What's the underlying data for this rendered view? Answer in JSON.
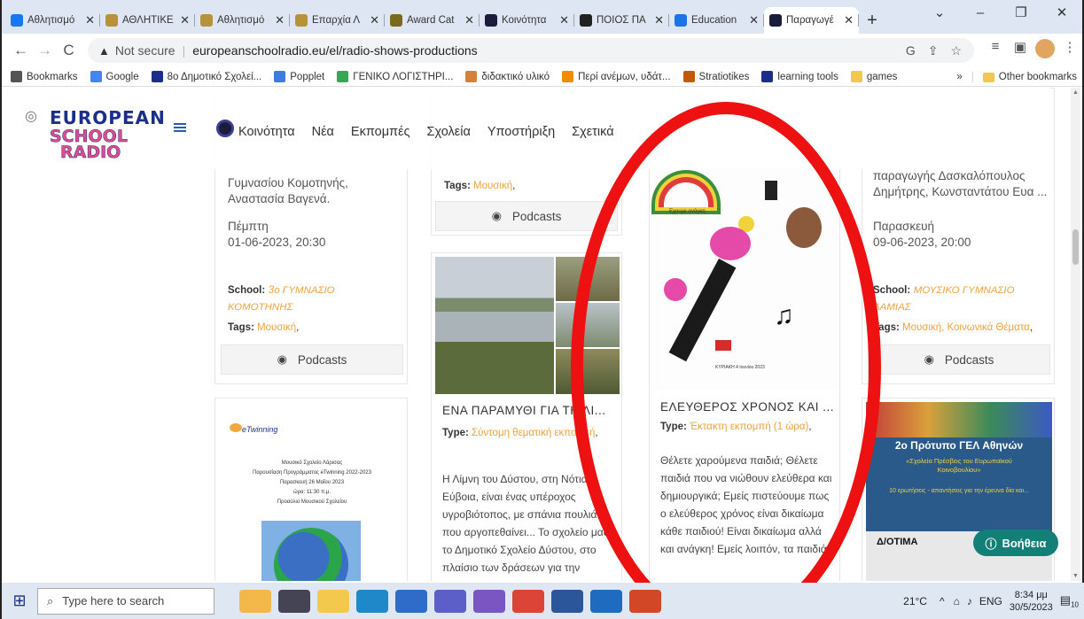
{
  "browser": {
    "tabs": [
      {
        "title": "Αθλητισμό",
        "color": "#1877f2",
        "active": false
      },
      {
        "title": "ΑΘΛΗΤΙΚΕ",
        "color": "#b8923a",
        "active": false
      },
      {
        "title": "Αθλητισμό",
        "color": "#b8923a",
        "active": false
      },
      {
        "title": "Επαρχία Λ",
        "color": "#b8923a",
        "active": false
      },
      {
        "title": "Award Cat",
        "color": "#7a6a1e",
        "active": false
      },
      {
        "title": "Κοινότητα",
        "color": "#1b1b3a",
        "active": false
      },
      {
        "title": "ΠΟΙΟΣ ΠΑ",
        "color": "#222222",
        "active": false
      },
      {
        "title": "Education",
        "color": "#1a73e8",
        "active": false
      },
      {
        "title": "Παραγωγέ",
        "color": "#1b1b3a",
        "active": true
      }
    ],
    "new_tab": "+",
    "window_controls": [
      "⌄",
      "–",
      "❐",
      "✕"
    ],
    "address": {
      "security": "Not secure",
      "url": "europeanschoolradio.eu/el/radio-shows-productions"
    },
    "bookmarks": [
      {
        "label": "Bookmarks",
        "color": "#555555"
      },
      {
        "label": "Google",
        "color": "#4285f4"
      },
      {
        "label": "8ο Δημοτικό Σχολεί...",
        "color": "#1b2f8a"
      },
      {
        "label": "Popplet",
        "color": "#3d7be0"
      },
      {
        "label": "ΓΕΝΙΚΟ ΛΟΓΙΣΤΗΡΙ...",
        "color": "#34a853"
      },
      {
        "label": "διδακτικό υλικό",
        "color": "#d6813a"
      },
      {
        "label": "Περί ανέμων, υδάτ...",
        "color": "#f28b00"
      },
      {
        "label": "Stratiotikes",
        "color": "#c25b00"
      },
      {
        "label": "learning tools",
        "color": "#1b2f8a"
      },
      {
        "label": "games",
        "color": "#f2c94c"
      }
    ],
    "bookmarks_more": "»",
    "other_bookmarks": "Other bookmarks"
  },
  "site": {
    "logo": {
      "line1": "EUROPEAN",
      "line2": "SCHOOL",
      "line3": "RADIO"
    },
    "nav": [
      "Κοινότητα",
      "Νέα",
      "Εκπομπές",
      "Σχολεία",
      "Υποστήριξη",
      "Σχετικά"
    ]
  },
  "cards": {
    "col1_top": {
      "text_tail": "Γυμνασίου Κομοτηνής, Αναστασία Βαγενά.",
      "day": "Πέμπτη",
      "date": "01-06-2023, 20:30",
      "school_label": "School:",
      "school_value": "3ο ΓΥΜΝΑΣΙΟ ΚΟΜΟΤΗΝΗΣ",
      "tags_label": "Tags:",
      "tags_value": "Μουσική",
      "podcasts": "Podcasts"
    },
    "col1_bottom": {
      "poster_brand": "eTwinning",
      "poster_lines": [
        "Μουσικό Σχολείο Λάρισας",
        "Παρουσίαση Προγράμματος eTwinning 2022-2023",
        "Παρασκευή 26 Μαΐου 2023",
        "ώρα: 11:30 π.μ.",
        "Προαύλιο Μουσικού Σχολείου"
      ]
    },
    "col2_top": {
      "tags_label": "Tags:",
      "tags_value": "Μουσική",
      "podcasts": "Podcasts"
    },
    "col2_bottom": {
      "title": "ΕΝΑ ΠΑΡΑΜΥΘΙ ΓΙΑ ΤΗ ΛΙ...",
      "type_label": "Type:",
      "type_value": "Σύντομη θεματική εκπομπή",
      "body": "Η Λίμνη του Δύστου, στη Νότια Εύβοια, είναι ένας υπέροχος υγροβιότοπος, με σπάνια πουλιά που αργοπεθαίνει... Το σχολείο μας, το Δημοτικό Σχολείο Δύστου, στο πλαίσιο των δράσεων για την προστασία της λίμνης, σας"
    },
    "col3": {
      "drawing_caption_1": "Εχουμε ανάγκη",
      "drawing_caption_2": "ΚΥΡΙΑΚΗ 4 Ιουνίου 2023",
      "title": "ΕΛΕΥΘΕΡΟΣ ΧΡΟΝΟΣ ΚΑΙ ...",
      "type_label": "Type:",
      "type_value": "Έκτακτη εκπομπή (1 ώρα)",
      "body": "Θέλετε χαρούμενα παιδιά; Θέλετε παιδιά που να νιώθουν ελεύθερα και δημιουργικά; Εμείς πιστεύουμε πως ο ελεύθερος χρόνος είναι δικαίωμα κάθε παιδιού! Είναι δικαίωμα αλλά και ανάγκη! Εμείς λοιπόν, τα παιδιά"
    },
    "col4_top": {
      "text_tail": "παραγωγής Δασκαλόπουλος Δημήτρης, Κωνσταντάτου Ευα ...",
      "day": "Παρασκευή",
      "date": "09-06-2023, 20:00",
      "school_label": "School:",
      "school_value": "ΜΟΥΣΙΚΟ ΓΥΜΝΑΣΙΟ ΛΑΜΙΑΣ",
      "tags_label": "Tags:",
      "tags_value": "Μουσική, Κοινωνικά Θέματα",
      "podcasts": "Podcasts"
    },
    "col4_bottom": {
      "poster_title": "2ο Πρότυπο ΓΕΛ Αθηνών",
      "poster_sub": "«Σχολεία Πρέσβεις του Ευρωπαϊκού Κοινοβουλίου»",
      "poster_note": "10 ερωτήσεις - απαντήσεις για την έρευνα δία και...",
      "poster_brand": "Δ/ΟΤΙΜΑ"
    }
  },
  "help": {
    "label": "Βοήθεια",
    "icon": "question-circle-icon"
  },
  "taskbar": {
    "search_placeholder": "Type here to search",
    "tray": {
      "temp": "21°C",
      "lang": "ENG",
      "time": "8:34 μμ",
      "date": "30/5/2023",
      "notif_count": "10"
    }
  },
  "colors": {
    "accent_orange": "#f0a33c",
    "annotation_red": "#ee1111",
    "help_teal": "#138078"
  }
}
